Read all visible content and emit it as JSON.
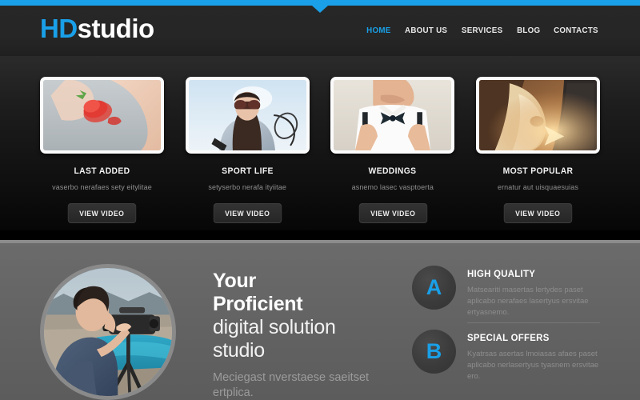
{
  "site": {
    "accent_color": "#19a0e8",
    "logo_primary": "HD",
    "logo_secondary": "studio"
  },
  "nav": {
    "items": [
      {
        "label": "HOME",
        "active": true
      },
      {
        "label": "ABOUT US",
        "active": false
      },
      {
        "label": "SERVICES",
        "active": false
      },
      {
        "label": "BLOG",
        "active": false
      },
      {
        "label": "CONTACTS",
        "active": false
      }
    ]
  },
  "showcase": {
    "cards": [
      {
        "title": "LAST ADDED",
        "desc": "vaserbo nerafaes sety eitylitae",
        "button": "VIEW VIDEO",
        "image_alt": "woman-biting-strawberry-photo"
      },
      {
        "title": "SPORT LIFE",
        "desc": "setyserbo nerafa ityiitae",
        "button": "VIEW VIDEO",
        "image_alt": "woman-sunglasses-tennis-racket-photo"
      },
      {
        "title": "WEDDINGS",
        "desc": "asnemo lasec vasptoerta",
        "button": "VIEW VIDEO",
        "image_alt": "groom-tying-bow-tie-photo"
      },
      {
        "title": "MOST POPULAR",
        "desc": "ernatur aut uisquaesuias",
        "button": "VIEW VIDEO",
        "image_alt": "warm-toned-suit-closeup-photo"
      }
    ]
  },
  "intro": {
    "portrait_alt": "cameraman-with-video-camera-on-tripod-photo",
    "headline_bold_1": "Your",
    "headline_bold_2": "Proficient",
    "headline_reg_1": "digital solution",
    "headline_reg_2": "studio",
    "subtext": "Meciegast nverstaese saeitset ertplica."
  },
  "features": [
    {
      "badge": "A",
      "title": "HIGH QUALITY",
      "text": "Matseariti masertas lertydes paset aplicabo nerafaes lasertyus ersvitae ertyasnemo."
    },
    {
      "badge": "B",
      "title": "SPECIAL OFFERS",
      "text": "Kyatrsas asertas lmoiasas afaes paset aplicabo nerlasertyus tyasnem ersvitae ero."
    }
  ]
}
